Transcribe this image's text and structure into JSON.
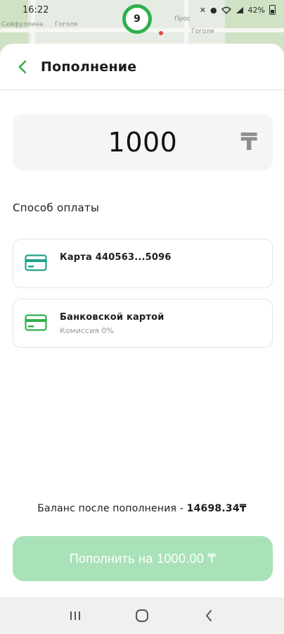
{
  "status_bar": {
    "time": "16:22",
    "battery": "42%",
    "icons": [
      "mute-icon",
      "location-icon",
      "wifi-icon",
      "signal-icon",
      "battery-icon"
    ]
  },
  "map": {
    "marker_count": "9",
    "streets": [
      "Сейфуллина",
      "Гоголя",
      "Гоголя",
      "Прос"
    ]
  },
  "header": {
    "title": "Пополнение",
    "back_icon": "chevron-left-icon"
  },
  "amount": {
    "value": "1000",
    "currency": "₸"
  },
  "payment": {
    "section_label": "Способ оплаты",
    "methods": [
      {
        "title": "Карта 440563...5096",
        "subtitle": "",
        "icon": "credit-card-icon",
        "icon_color": "#1fa38a"
      },
      {
        "title": "Банковской картой",
        "subtitle": "Комиссия 0%",
        "icon": "credit-card-icon",
        "icon_color": "#2fb14c"
      }
    ]
  },
  "balance": {
    "label": "Баланс после пополнения - ",
    "value": "14698.34₸"
  },
  "submit": {
    "label": "Пополнить на 1000.00 ₸"
  },
  "navbar": {
    "items": [
      "recent-apps-icon",
      "home-icon",
      "back-icon"
    ]
  },
  "colors": {
    "accent": "#2fb14c",
    "button_disabled": "#a9e2b8",
    "input_bg": "#f5f5f5"
  }
}
